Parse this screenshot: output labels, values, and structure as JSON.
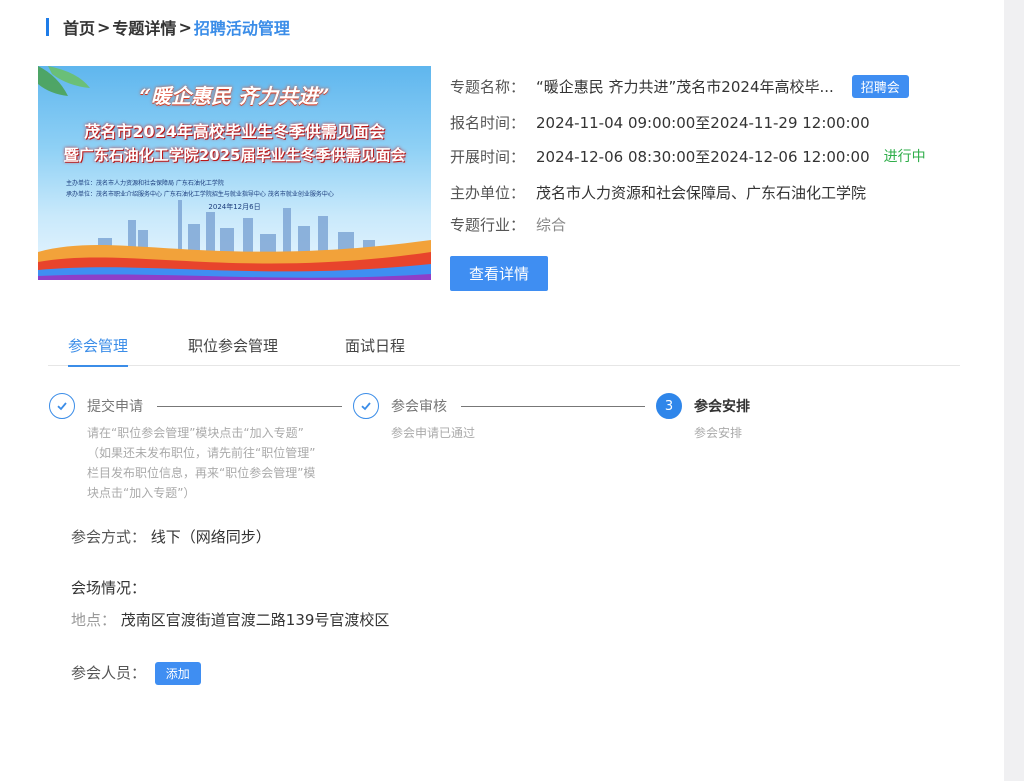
{
  "breadcrumb": {
    "home": "首页",
    "topic": "专题详情",
    "current": "招聘活动管理",
    "sep": ">"
  },
  "banner": {
    "slogan": "“暖企惠民  齐力共进”",
    "line1": "茂名市2024年高校毕业生冬季供需见面会",
    "line2": "暨广东石油化工学院2025届毕业生冬季供需见面会",
    "organizer": "主办单位：茂名市人力资源和社会保障局    广东石油化工学院",
    "co_organizer": "承办单位：茂名市职业介绍服务中心    广东石油化工学院招生与就业指导中心    茂名市就业创业服务中心",
    "date": "2024年12月6日"
  },
  "info": {
    "name_label": "专题名称：",
    "name_value": "“暖企惠民 齐力共进”茂名市2024年高校毕...",
    "tag": "招聘会",
    "signup_label": "报名时间：",
    "signup_value": "2024-11-04 09:00:00至2024-11-29 12:00:00",
    "open_label": "开展时间：",
    "open_value": "2024-12-06 08:30:00至2024-12-06 12:00:00",
    "status": "进行中",
    "host_label": "主办单位：",
    "host_value": "茂名市人力资源和社会保障局、广东石油化工学院",
    "industry_label": "专题行业：",
    "industry_value": "综合",
    "detail_button": "查看详情"
  },
  "tabs": [
    {
      "label": "参会管理",
      "active": true
    },
    {
      "label": "职位参会管理",
      "active": false
    },
    {
      "label": "面试日程",
      "active": false
    }
  ],
  "steps": [
    {
      "title": "提交申请",
      "desc": [
        "请在“职位参会管理”模块点击“加入专题”",
        "（如果还未发布职位，请先前往“职位管理”",
        "栏目发布职位信息，再来“职位参会管理”模",
        "块点击“加入专题”）"
      ]
    },
    {
      "title": "参会审核",
      "desc": [
        "参会申请已通过"
      ]
    },
    {
      "number": "3",
      "title": "参会安排",
      "desc": [
        "参会安排"
      ]
    }
  ],
  "attend_mode": {
    "label": "参会方式：",
    "value": "线下（网络同步）"
  },
  "venue": {
    "label": "会场情况：",
    "location_label": "地点：",
    "location_value": "茂南区官渡街道官渡二路139号官渡校区"
  },
  "attendees": {
    "label": "参会人员：",
    "add_button": "添加"
  },
  "colors": {
    "primary": "#3f8ef2",
    "status_green": "#2fae4a",
    "breadcrumb_current": "#3b8de8"
  }
}
